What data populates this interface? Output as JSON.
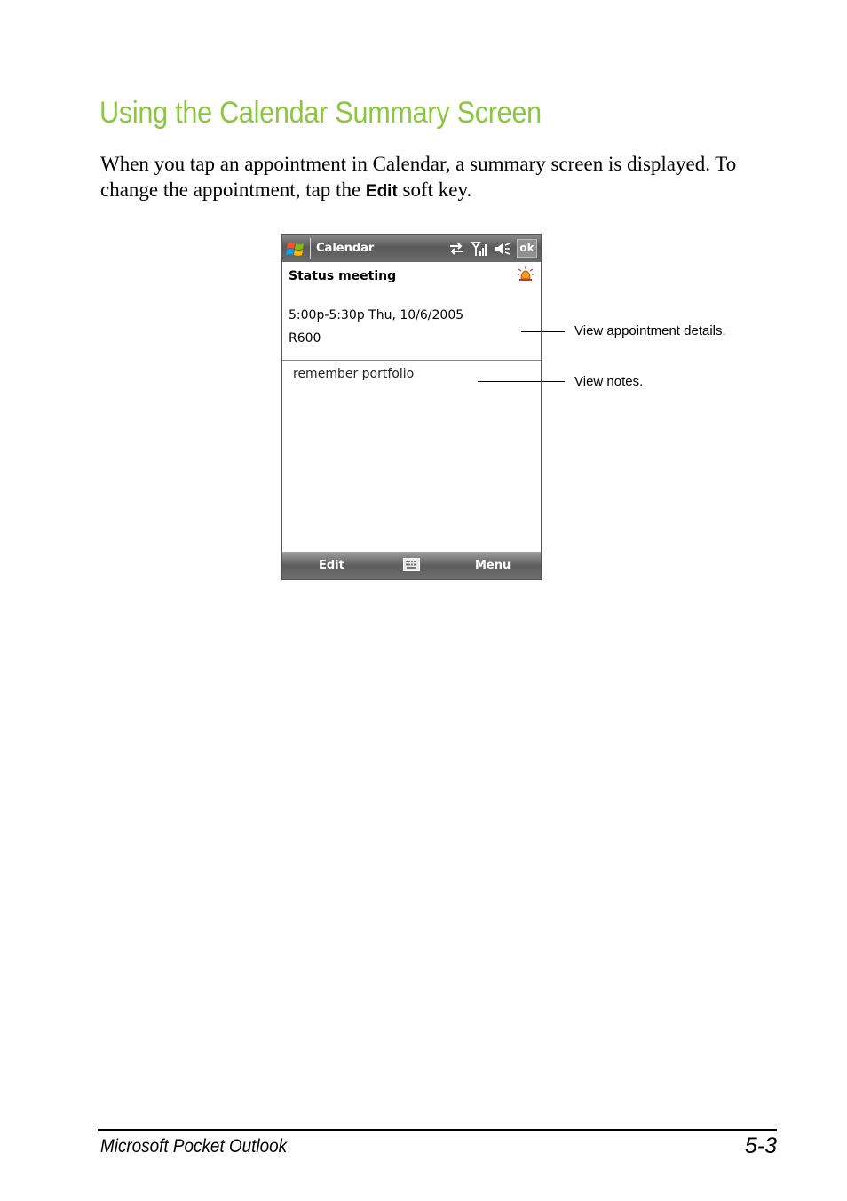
{
  "heading": "Using the Calendar Summary Screen",
  "intro": {
    "before": "When you tap an appointment in Calendar, a summary screen is displayed. To change the appointment, tap the ",
    "key": "Edit",
    "after": " soft key."
  },
  "device": {
    "title": "Calendar",
    "ok_label": "ok",
    "subject": "Status meeting",
    "when": "5:00p-5:30p Thu, 10/6/2005",
    "location": "R600",
    "notes": "remember portfolio",
    "softkey_left": "Edit",
    "softkey_right": "Menu",
    "icons": [
      "windows-start-icon",
      "connectivity-icon",
      "signal-icon",
      "speaker-icon",
      "alarm-bell-icon",
      "keyboard-icon"
    ]
  },
  "callouts": {
    "details": "View appointment details.",
    "notes": "View notes."
  },
  "footer": {
    "chapter": "Microsoft Pocket Outlook",
    "page": "5-3"
  }
}
